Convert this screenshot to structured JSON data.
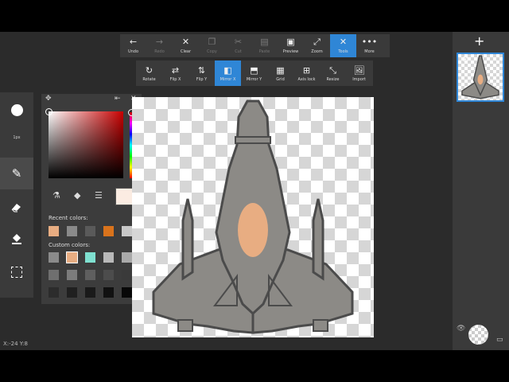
{
  "toolbar": {
    "buttons": [
      {
        "label": "Undo",
        "icon": "undo-icon",
        "glyph": "←",
        "state": "normal"
      },
      {
        "label": "Redo",
        "icon": "redo-icon",
        "glyph": "→",
        "state": "disabled"
      },
      {
        "label": "Clear",
        "icon": "clear-icon",
        "glyph": "✕",
        "state": "normal"
      },
      {
        "label": "Copy",
        "icon": "copy-icon",
        "glyph": "❐",
        "state": "disabled"
      },
      {
        "label": "Cut",
        "icon": "cut-icon",
        "glyph": "✂",
        "state": "disabled"
      },
      {
        "label": "Paste",
        "icon": "paste-icon",
        "glyph": "▤",
        "state": "disabled"
      },
      {
        "label": "Preview",
        "icon": "preview-icon",
        "glyph": "▣",
        "state": "normal"
      },
      {
        "label": "Zoom",
        "icon": "zoom-icon",
        "glyph": "⤢",
        "state": "normal"
      },
      {
        "label": "Tools",
        "icon": "tools-icon",
        "glyph": "✕",
        "state": "active"
      },
      {
        "label": "More",
        "icon": "more-icon",
        "glyph": "•••",
        "state": "normal"
      }
    ]
  },
  "submenu": {
    "buttons": [
      {
        "label": "Rotate",
        "icon": "rotate-icon",
        "glyph": "↻",
        "state": "normal"
      },
      {
        "label": "Flip X",
        "icon": "flip-x-icon",
        "glyph": "⇄",
        "state": "normal"
      },
      {
        "label": "Flip Y",
        "icon": "flip-y-icon",
        "glyph": "⇅",
        "state": "normal"
      },
      {
        "label": "Mirror X",
        "icon": "mirror-x-icon",
        "glyph": "◧",
        "state": "active"
      },
      {
        "label": "Mirror Y",
        "icon": "mirror-y-icon",
        "glyph": "⬒",
        "state": "normal"
      },
      {
        "label": "Grid",
        "icon": "grid-icon",
        "glyph": "▦",
        "state": "normal"
      },
      {
        "label": "Axis lock",
        "icon": "axis-lock-icon",
        "glyph": "⊞",
        "state": "normal"
      },
      {
        "label": "Resize",
        "icon": "resize-icon",
        "glyph": "⤡",
        "state": "normal"
      },
      {
        "label": "Import",
        "icon": "import-icon",
        "glyph": "🖼",
        "state": "normal"
      }
    ]
  },
  "left_tools": {
    "brush_size_label": "1px"
  },
  "color_panel": {
    "recent_label": "Recent colors:",
    "custom_label": "Custom colors:",
    "current_color": "#fbece2",
    "recent_colors": [
      "#e8ad82",
      "#8a8a8a",
      "#5a5a5a",
      "#d9731c",
      "#c8c8c8"
    ],
    "custom_colors": [
      "#8b8b8b",
      "#e8ad82",
      "#7fe0d0",
      "#b9b9b9",
      "#a9a9a9",
      "#6f6f6f",
      "#7c7c7c",
      "#5f5f5f",
      "#4c4c4c",
      "#3a3a3a",
      "#2c2c2c",
      "#202020",
      "#1a1a1a",
      "#111111",
      "#080808"
    ],
    "selected_custom_index": 1
  },
  "ship": {
    "body_color": "#8c8a86",
    "outline_color": "#4b4b4b",
    "cockpit_color": "#e8ad82"
  },
  "status": {
    "coords": "X:-24 Y:8"
  }
}
